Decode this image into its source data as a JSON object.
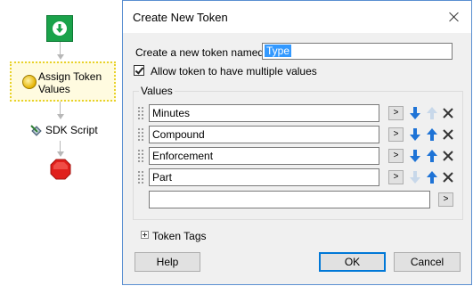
{
  "workflow": {
    "nodes": [
      {
        "name": "start",
        "icon": "green-down-arrow-icon"
      },
      {
        "name": "assign",
        "label_line1": "Assign Token",
        "label_line2": "Values",
        "icon": "coin-icon",
        "selected": true
      },
      {
        "name": "sdk",
        "label": "SDK Script",
        "icon": "sdk-script-icon"
      },
      {
        "name": "end",
        "icon": "red-stop-icon"
      }
    ]
  },
  "dialog": {
    "title": "Create New Token",
    "name_label": "Create a new token named:",
    "name_value": "Type",
    "allow_multiple_label": "Allow token to have multiple values",
    "allow_multiple_checked": true,
    "values_group_label": "Values",
    "values": [
      {
        "value": "Minutes",
        "browse": ">",
        "down_enabled": true,
        "up_enabled": false
      },
      {
        "value": "Compound",
        "browse": ">",
        "down_enabled": true,
        "up_enabled": true
      },
      {
        "value": "Enforcement",
        "browse": ">",
        "down_enabled": true,
        "up_enabled": true
      },
      {
        "value": "Part",
        "browse": ">",
        "down_enabled": false,
        "up_enabled": true
      }
    ],
    "new_value": "",
    "new_value_browse": ">",
    "token_tags_label": "Token Tags",
    "buttons": {
      "help": "Help",
      "ok": "OK",
      "cancel": "Cancel"
    }
  },
  "colors": {
    "arrow_blue": "#1e73d6",
    "arrow_disabled": "#c8d8ea",
    "selection_blue": "#3399ff",
    "start_green": "#1aa24a",
    "stop_red": "#e0201c"
  }
}
